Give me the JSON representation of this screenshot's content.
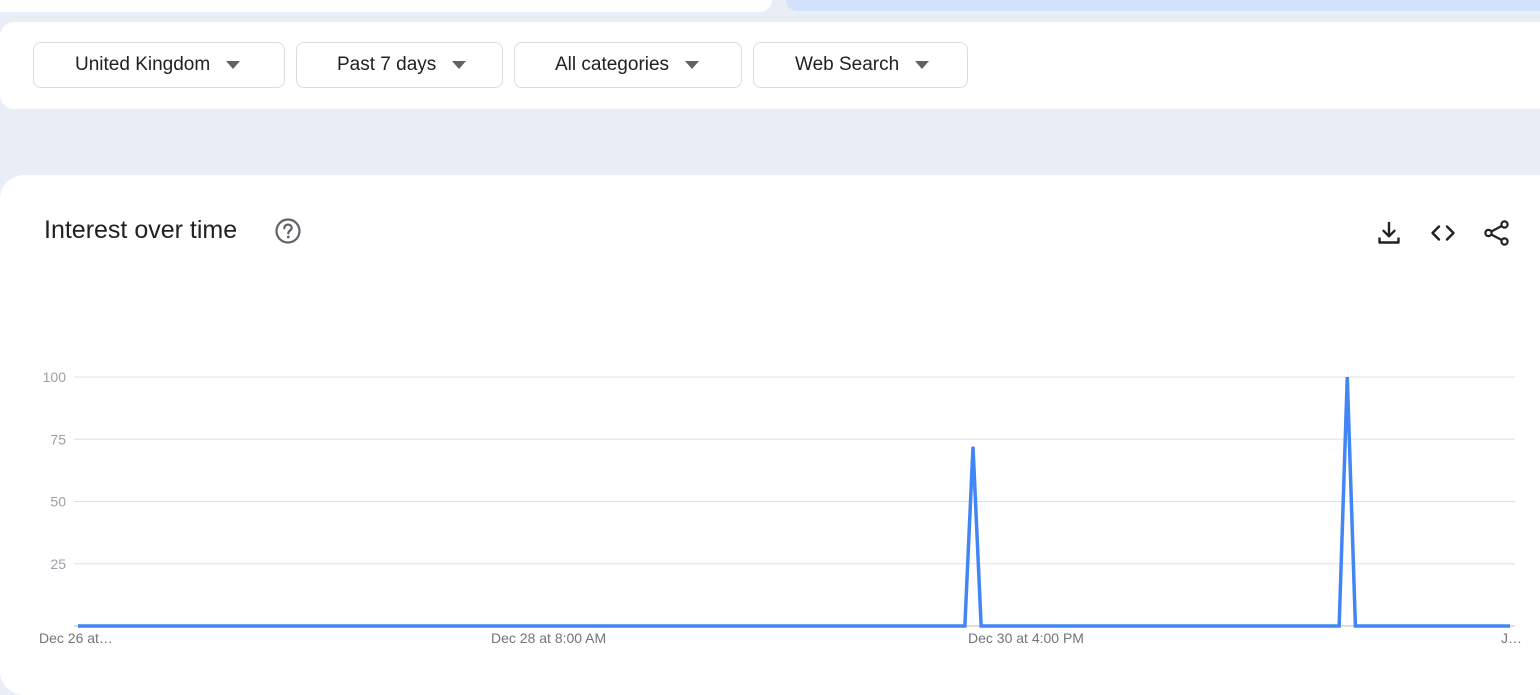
{
  "filters": {
    "region": "United Kingdom",
    "time_range": "Past 7 days",
    "category": "All categories",
    "search_type": "Web Search"
  },
  "card": {
    "title": "Interest over time"
  },
  "icons": {
    "help": "help-circle-icon",
    "download": "download-icon",
    "embed": "code-icon",
    "share": "share-icon"
  },
  "colors": {
    "line": "#4285f4",
    "grid": "#e0e0e0",
    "background": "#e9eef6",
    "filter_bar_accent": "#d3e3fd"
  },
  "chart_data": {
    "type": "line",
    "title": "",
    "xlabel": "",
    "ylabel": "",
    "ylim": [
      0,
      100
    ],
    "yticks": [
      100,
      75,
      50,
      25
    ],
    "x_tick_labels": [
      "Dec 26 at…",
      "Dec 28 at 8:00 AM",
      "Dec 30 at 4:00 PM",
      "J…"
    ],
    "grid": true,
    "series": [
      {
        "values": [
          0,
          0,
          0,
          0,
          0,
          0,
          0,
          0,
          0,
          0,
          0,
          0,
          0,
          0,
          0,
          0,
          0,
          0,
          0,
          0,
          0,
          0,
          0,
          0,
          0,
          0,
          0,
          0,
          0,
          0,
          0,
          0,
          0,
          0,
          0,
          0,
          0,
          0,
          0,
          0,
          0,
          0,
          0,
          0,
          0,
          0,
          0,
          0,
          0,
          0,
          0,
          0,
          0,
          0,
          0,
          0,
          0,
          0,
          0,
          0,
          0,
          0,
          0,
          0,
          0,
          0,
          0,
          0,
          0,
          0,
          0,
          0,
          0,
          0,
          0,
          0,
          0,
          0,
          0,
          0,
          0,
          0,
          0,
          0,
          0,
          0,
          0,
          0,
          0,
          0,
          0,
          0,
          0,
          0,
          0,
          0,
          0,
          0,
          0,
          0,
          0,
          0,
          0,
          0,
          0,
          0,
          0,
          0,
          0,
          0,
          72,
          0,
          0,
          0,
          0,
          0,
          0,
          0,
          0,
          0,
          0,
          0,
          0,
          0,
          0,
          0,
          0,
          0,
          0,
          0,
          0,
          0,
          0,
          0,
          0,
          0,
          0,
          0,
          0,
          0,
          0,
          0,
          0,
          0,
          0,
          0,
          0,
          0,
          0,
          0,
          0,
          0,
          0,
          0,
          0,
          0,
          100,
          0,
          0,
          0,
          0,
          0,
          0,
          0,
          0,
          0,
          0,
          0,
          0,
          0,
          0,
          0,
          0,
          0,
          0,
          0,
          0
        ]
      }
    ]
  }
}
